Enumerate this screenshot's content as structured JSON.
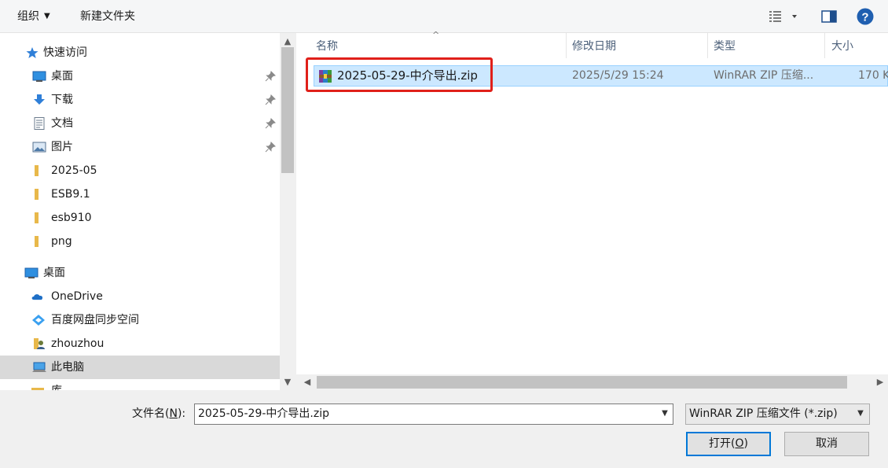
{
  "toolbar": {
    "organize_label": "组织",
    "new_folder_label": "新建文件夹"
  },
  "nav": {
    "items": [
      {
        "label": "快速访问",
        "icon": "star-icon",
        "pinned": false
      },
      {
        "label": "桌面",
        "icon": "desktop-icon",
        "pinned": true
      },
      {
        "label": "下载",
        "icon": "download-icon",
        "pinned": true
      },
      {
        "label": "文档",
        "icon": "document-icon",
        "pinned": true
      },
      {
        "label": "图片",
        "icon": "pictures-icon",
        "pinned": true
      },
      {
        "label": "2025-05",
        "icon": "folder-icon",
        "pinned": false
      },
      {
        "label": "ESB9.1",
        "icon": "folder-icon",
        "pinned": false
      },
      {
        "label": "esb910",
        "icon": "folder-icon",
        "pinned": false
      },
      {
        "label": "png",
        "icon": "folder-icon",
        "pinned": false
      },
      {
        "label": "桌面",
        "icon": "desktop-icon",
        "pinned": false
      },
      {
        "label": "OneDrive",
        "icon": "cloud-icon",
        "pinned": false
      },
      {
        "label": "百度网盘同步空间",
        "icon": "baidu-netdisk-icon",
        "pinned": false
      },
      {
        "label": "zhouzhou",
        "icon": "user-icon",
        "pinned": false
      },
      {
        "label": "此电脑",
        "icon": "computer-icon",
        "pinned": false,
        "selected": true
      },
      {
        "label": "库",
        "icon": "library-icon",
        "pinned": false
      }
    ]
  },
  "columns": {
    "name": "名称",
    "modified": "修改日期",
    "type": "类型",
    "size": "大小"
  },
  "files": [
    {
      "name": "2025-05-29-中介导出.zip",
      "modified": "2025/5/29 15:24",
      "type": "WinRAR ZIP 压缩...",
      "size": "170 K",
      "icon": "winrar-archive-icon"
    }
  ],
  "bottom": {
    "filename_label": "文件名(",
    "filename_accel": "N",
    "filename_label_end": "):",
    "filename_value": "2025-05-29-中介导出.zip",
    "filetype_value": "WinRAR ZIP 压缩文件 (*.zip)",
    "open_label": "打开(",
    "open_accel": "O",
    "open_label_end": ")",
    "cancel_label": "取消"
  },
  "colors": {
    "selection": "#cce8ff",
    "highlight_border": "#e0201a",
    "accent": "#0078d7"
  }
}
